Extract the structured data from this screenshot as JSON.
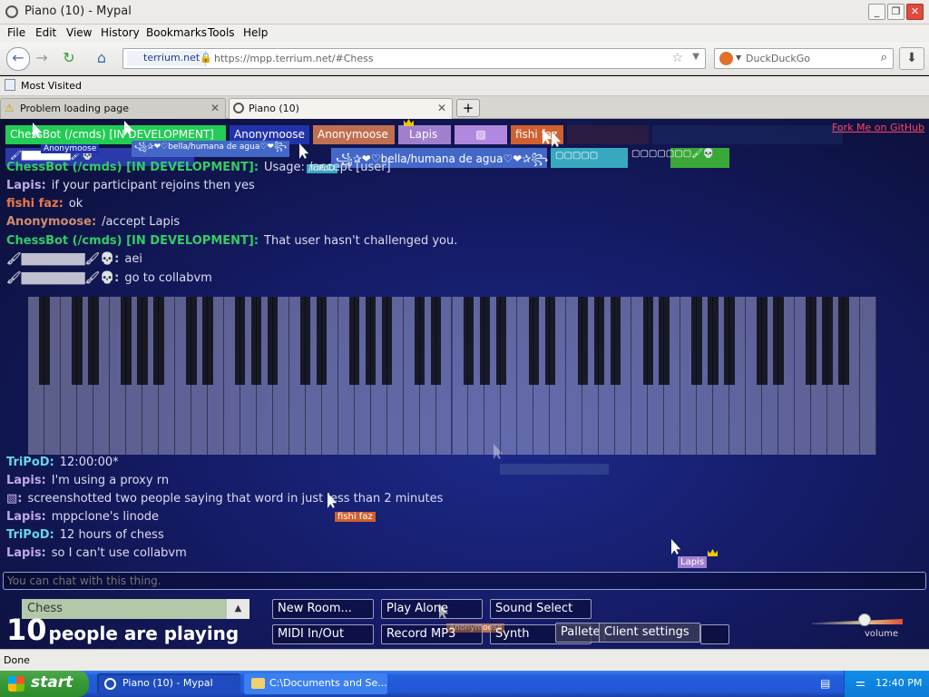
{
  "window": {
    "title": "Piano (10) - Mypal"
  },
  "menu": [
    "File",
    "Edit",
    "View",
    "History",
    "Bookmarks",
    "Tools",
    "Help"
  ],
  "url": {
    "site": "terrium.net",
    "text": "https://mpp.terrium.net/#Chess"
  },
  "search": {
    "placeholder": "DuckDuckGo"
  },
  "bookmarks": {
    "most_visited": "Most Visited"
  },
  "tabs": [
    {
      "label": "Problem loading page"
    },
    {
      "label": "Piano (10)"
    }
  ],
  "participants": [
    {
      "name": "ChessBot (/cmds) [IN DEVELOPMENT]",
      "color": "#22cc55"
    },
    {
      "name": "Anonymoose",
      "color": "#2233aa"
    },
    {
      "name": "Anonymoose",
      "color": "#c07050"
    },
    {
      "name": "Lapis",
      "color": "#a080cc"
    },
    {
      "name": "▧",
      "color": "#b088e0"
    },
    {
      "name": "fishi faz",
      "color": "#d06030"
    }
  ],
  "participants_row2": [
    {
      "name": "꧁✰❤♡bella/humana de agua♡❤✰꧂",
      "color": "#4468c8"
    }
  ],
  "fork": "Fork Me on GitHub",
  "cursor_tags": {
    "anonymoose1": "Anonymoose",
    "bella": "꧁✰❤♡bella/humana de agua♡❤꧂",
    "tripod": "TriPoD",
    "fishi": "fishi faz",
    "lapis": "Lapis",
    "anonymoose2": "Anonymoose"
  },
  "chat": [
    {
      "name": "ChessBot (/cmds) [IN DEVELOPMENT]:",
      "text": "Usage: /accept [user]",
      "color": "#33cc66"
    },
    {
      "name": "Lapis:",
      "text": "if your participant rejoins then yes",
      "color": "#c0a8e8"
    },
    {
      "name": "fishi faz:",
      "text": "ok",
      "color": "#e8784a"
    },
    {
      "name": "Anonymoose:",
      "text": "/accept Lapis",
      "color": "#d08c70"
    },
    {
      "name": "ChessBot (/cmds) [IN DEVELOPMENT]:",
      "text": "That user hasn't challenged you.",
      "color": "#33cc66"
    },
    {
      "name": "🖌▇▇▇▇▇▇▇🖌💀:",
      "text": "aei",
      "color": "#c0c0d0"
    },
    {
      "name": "🖌▇▇▇▇▇▇▇🖌💀:",
      "text": "go to collabvm",
      "color": "#c0c0d0"
    },
    {
      "name": "TriPoD:",
      "text": "12:00:00*",
      "color": "#66d6e6"
    },
    {
      "name": "Lapis:",
      "text": "I'm using a proxy rn",
      "color": "#c0a8e8"
    },
    {
      "name": "▧:",
      "text": "screenshotted two people saying that word in just less than 2 minutes",
      "color": "#c8b8f0"
    },
    {
      "name": "Lapis:",
      "text": "mppclone's linode",
      "color": "#c0a8e8"
    },
    {
      "name": "TriPoD:",
      "text": "12 hours of chess",
      "color": "#66d6e6"
    },
    {
      "name": "Lapis:",
      "text": "so I can't use collabvm",
      "color": "#c0a8e8"
    }
  ],
  "chat_input": {
    "placeholder": "You can chat with this thing."
  },
  "room": {
    "name": "Chess"
  },
  "playing": {
    "count": "10",
    "label": "people are playing"
  },
  "controls": {
    "new_room": "New Room...",
    "play_alone": "Play Alone",
    "sound_select": "Sound Select",
    "midi": "MIDI In/Out",
    "record": "Record MP3",
    "synth": "Synth",
    "pallete": "Pallete",
    "client_settings": "Client settings"
  },
  "volume": {
    "label": "volume",
    "level": 0.58
  },
  "status": {
    "text": "Done"
  },
  "taskbar": {
    "start": "start",
    "tasks": [
      "Piano (10) - Mypal",
      "C:\\Documents and Se..."
    ],
    "clock": "12:40 PM"
  },
  "icons": [
    "back-arrow-icon",
    "forward-arrow-icon",
    "reload-icon",
    "home-icon",
    "lock-icon",
    "star-icon",
    "search-icon",
    "download-icon",
    "warning-icon",
    "crown-icon",
    "cursor-icon",
    "windows-logo-icon"
  ],
  "colors": {
    "accent_green": "#22cc55",
    "background": "#151b66",
    "fork_link": "#ff4466"
  }
}
